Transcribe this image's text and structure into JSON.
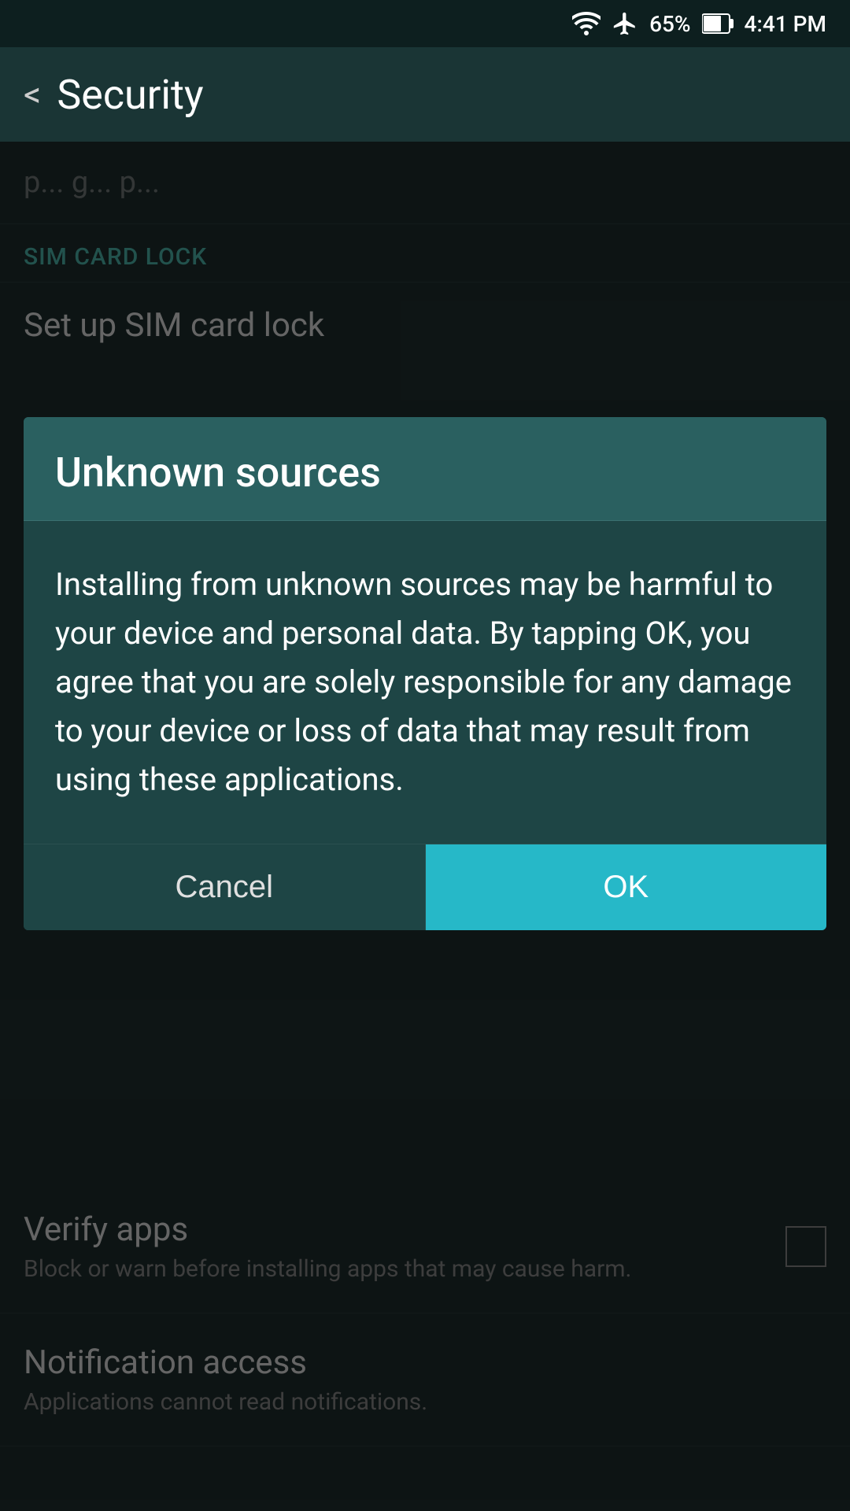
{
  "statusBar": {
    "battery": "65%",
    "time": "4:41 PM"
  },
  "header": {
    "backLabel": "<",
    "title": "Security"
  },
  "partialContent": {
    "text": "p... g... p..."
  },
  "simSection": {
    "label": "SIM CARD LOCK",
    "item": "Set up SIM card lock"
  },
  "dialog": {
    "title": "Unknown sources",
    "message": "Installing from unknown sources may be harmful to your device and personal data. By tapping OK, you agree that you are solely responsible for any damage to your device or loss of data that may result from using these applications.",
    "cancelLabel": "Cancel",
    "okLabel": "OK"
  },
  "verifyApps": {
    "title": "Verify apps",
    "subtitle": "Block or warn before installing apps that may cause harm."
  },
  "notificationAccess": {
    "title": "Notification access",
    "subtitle": "Applications cannot read notifications."
  },
  "icons": {
    "wifi": "📶",
    "airplane": "✈",
    "battery": "🔋"
  }
}
